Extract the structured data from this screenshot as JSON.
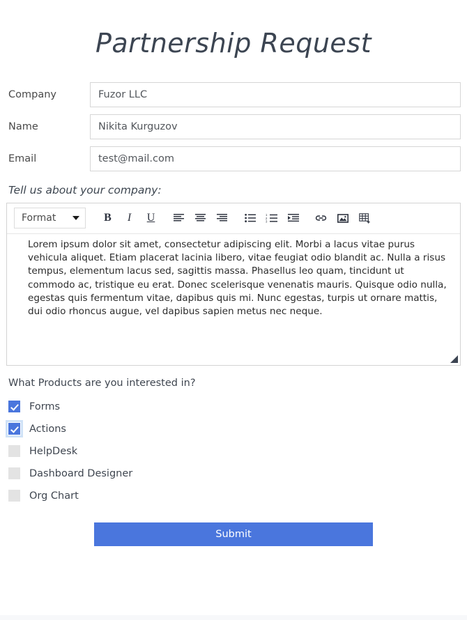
{
  "form": {
    "title": "Partnership Request",
    "fields": [
      {
        "label": "Company",
        "value": "Fuzor LLC",
        "name": "company"
      },
      {
        "label": "Name",
        "value": "Nikita Kurguzov",
        "name": "name"
      },
      {
        "label": "Email",
        "value": "test@mail.com",
        "name": "email"
      }
    ],
    "editor": {
      "label": "Tell us about your company:",
      "format_select": "Format",
      "toolbar": [
        {
          "icon": "bold-icon",
          "label": "B"
        },
        {
          "icon": "italic-icon",
          "label": "I"
        },
        {
          "icon": "underline-icon",
          "label": "U"
        },
        {
          "icon": "align-left-icon",
          "label": ""
        },
        {
          "icon": "align-center-icon",
          "label": ""
        },
        {
          "icon": "align-right-icon",
          "label": ""
        },
        {
          "icon": "bulleted-list-icon",
          "label": ""
        },
        {
          "icon": "numbered-list-icon",
          "label": ""
        },
        {
          "icon": "indent-icon",
          "label": ""
        },
        {
          "icon": "link-icon",
          "label": ""
        },
        {
          "icon": "image-icon",
          "label": ""
        },
        {
          "icon": "table-icon",
          "label": ""
        }
      ],
      "content": "Lorem ipsum dolor sit amet, consectetur adipiscing elit. Morbi a lacus vitae purus vehicula aliquet. Etiam placerat lacinia libero, vitae feugiat odio blandit ac. Nulla a risus tempus, elementum lacus sed, sagittis massa. Phasellus leo quam, tincidunt ut commodo ac, tristique eu erat. Donec scelerisque venenatis mauris. Quisque odio nulla, egestas quis fermentum vitae, dapibus quis mi. Nunc egestas, turpis ut ornare mattis, dui odio rhoncus augue, vel dapibus sapien metus nec neque."
    },
    "products": {
      "question": "What Products are you interested in?",
      "options": [
        {
          "label": "Forms",
          "checked": true,
          "focused": false
        },
        {
          "label": "Actions",
          "checked": true,
          "focused": true
        },
        {
          "label": "HelpDesk",
          "checked": false,
          "focused": false
        },
        {
          "label": "Dashboard Designer",
          "checked": false,
          "focused": false
        },
        {
          "label": "Org Chart",
          "checked": false,
          "focused": false
        }
      ]
    },
    "submit_label": "Submit"
  },
  "colors": {
    "accent_blue": "#4a76dd",
    "focus_ring": "#cfe2f7",
    "border_gray": "#d6d6d6",
    "checkbox_unchecked": "#e3e3e3",
    "title_text": "#3c4552"
  }
}
